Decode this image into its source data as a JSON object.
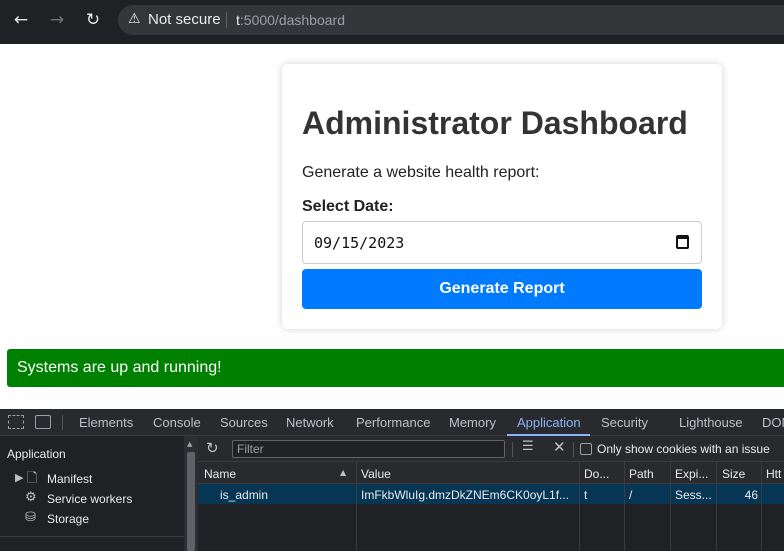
{
  "browser": {
    "security_text": "Not secure",
    "url_prefix": "t",
    "url_rest": ":5000/dashboard"
  },
  "page": {
    "title": "Administrator Dashboard",
    "subtitle": "Generate a website health report:",
    "date_label": "Select Date:",
    "date_value": "09/15/2023",
    "button_label": "Generate Report",
    "status_message": "Systems are up and running!",
    "colors": {
      "button": "#007bff",
      "status": "#008000"
    }
  },
  "devtools": {
    "tabs": [
      "Elements",
      "Console",
      "Sources",
      "Network",
      "Performance",
      "Memory",
      "Application",
      "Security",
      "Lighthouse",
      "DOM"
    ],
    "active_tab": "Application",
    "sidebar": {
      "title": "Application",
      "items": [
        "Manifest",
        "Service workers",
        "Storage"
      ]
    },
    "cookies": {
      "filter_placeholder": "Filter",
      "only_issues_label": "Only show cookies with an issue",
      "columns": [
        "Name",
        "Value",
        "Do...",
        "Path",
        "Expi...",
        "Size",
        "Htt"
      ],
      "rows": [
        {
          "name": "is_admin",
          "value": "ImFkbWluIg.dmzDkZNEm6CK0oyL1f...",
          "domain": "t",
          "path": "/",
          "expires": "Sess...",
          "size": "46",
          "http": ""
        }
      ]
    }
  }
}
